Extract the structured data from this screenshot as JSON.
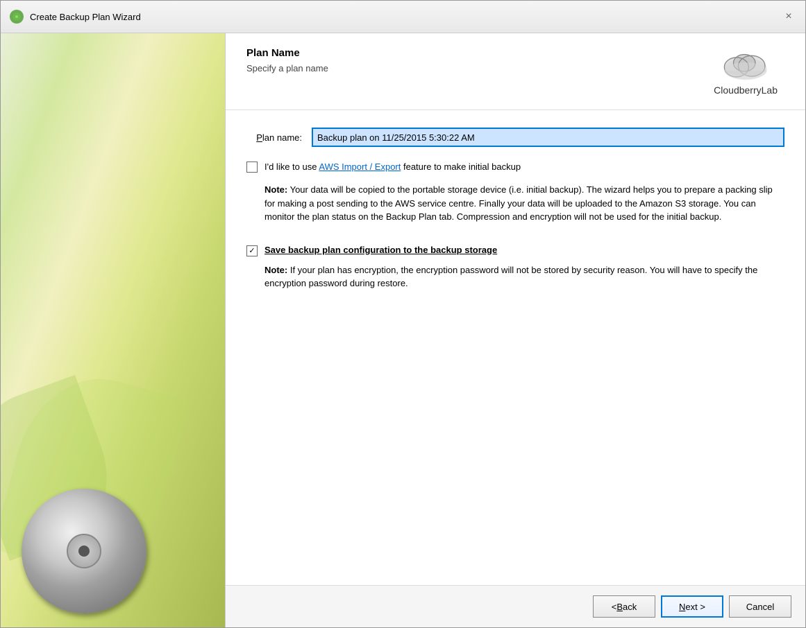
{
  "titleBar": {
    "title": "Create Backup Plan Wizard",
    "closeLabel": "×"
  },
  "header": {
    "title": "Plan Name",
    "subtitle": "Specify a plan name",
    "logoText": "CloudberryLab"
  },
  "form": {
    "planNameLabel": "Plan name:",
    "planNameLabelUnderline": "P",
    "planNameValue": "Backup plan on 11/25/2015 5:30:22 AM",
    "awsCheckboxLabel1": "I'd like to use ",
    "awsLinkText": "AWS Import / Export",
    "awsCheckboxLabel2": " feature to make initial backup",
    "awsChecked": false,
    "awsNote": "Note:  Your data will be copied to the portable storage device (i.e. initial backup). The wizard helps you to prepare a packing slip for making a post sending to the AWS service centre. Finally your data will be uploaded to the Amazon S3 storage. You can monitor the plan status on the Backup Plan tab. Compression and encryption will not be used for the initial backup.",
    "saveConfigChecked": true,
    "saveConfigLabel": "Save backup plan configuration to the backup storage",
    "saveConfigNote": "Note:  If your plan has encryption, the encryption password will not be stored by security reason. You will have to specify the encryption password during restore."
  },
  "footer": {
    "backLabel": "< Back",
    "backUnderline": "B",
    "nextLabel": "Next >",
    "nextUnderline": "N",
    "cancelLabel": "Cancel"
  }
}
